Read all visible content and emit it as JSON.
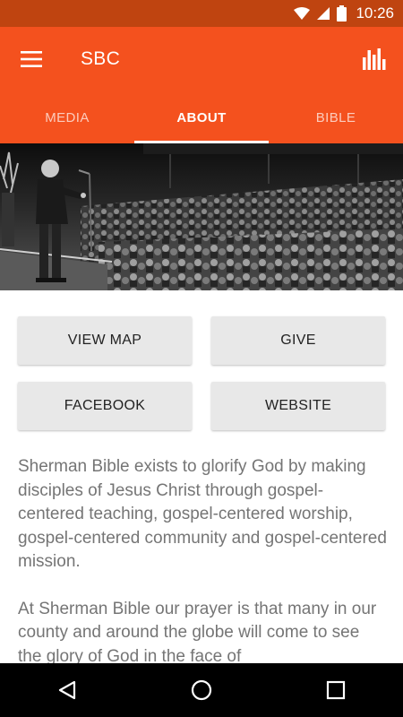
{
  "status_bar": {
    "time": "10:26",
    "icons": [
      "wifi-icon",
      "cell-signal-icon",
      "battery-icon"
    ]
  },
  "app_bar": {
    "title": "SBC",
    "menu_icon": "hamburger-menu-icon",
    "action_icon": "bar-chart-icon"
  },
  "tabs": [
    {
      "label": "MEDIA",
      "active": false
    },
    {
      "label": "ABOUT",
      "active": true
    },
    {
      "label": "BIBLE",
      "active": false
    }
  ],
  "buttons": {
    "view_map": "VIEW MAP",
    "give": "GIVE",
    "facebook": "FACEBOOK",
    "website": "WEBSITE"
  },
  "about": {
    "paragraph1": "Sherman Bible exists to glorify God by making disciples of Jesus Christ through gospel-centered teaching, gospel-centered worship, gospel-centered community and gospel-centered mission.",
    "paragraph2": "At Sherman Bible our prayer is that many in our county and around the globe will come to see the glory of God in the face of"
  },
  "colors": {
    "primary": "#f4511e",
    "status_bar": "#bf4410",
    "button_bg": "#e8e8e8",
    "body_text": "#757575"
  },
  "nav_bar": {
    "icons": [
      "back-triangle-icon",
      "home-circle-icon",
      "recents-square-icon"
    ]
  }
}
